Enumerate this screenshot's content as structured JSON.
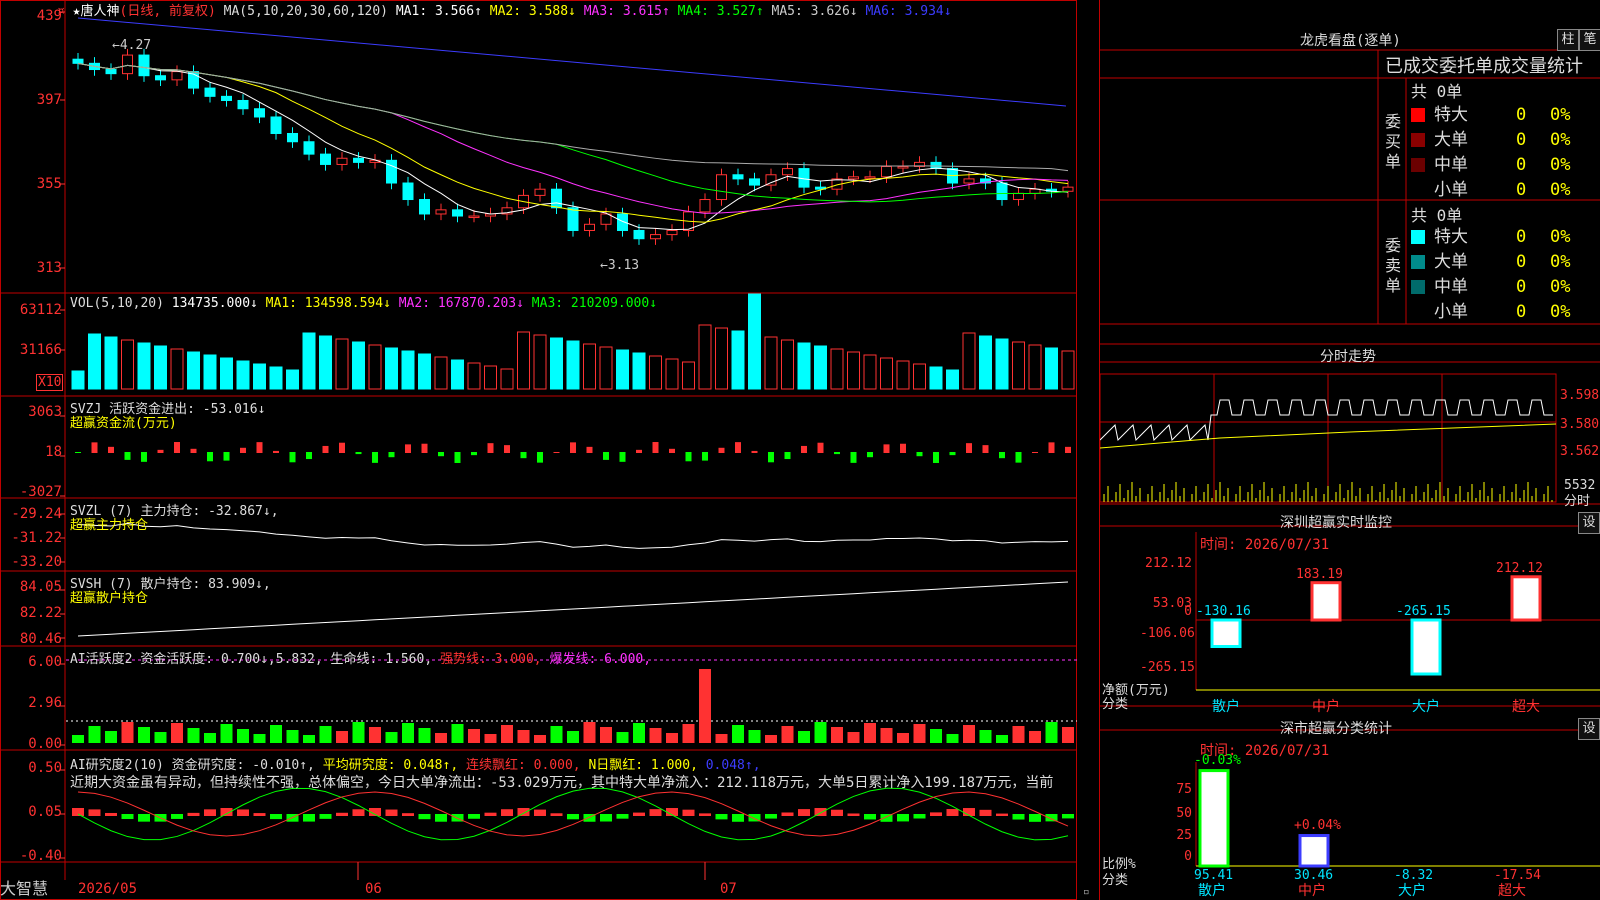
{
  "main": {
    "title_star": "★",
    "stock_name": "唐人神",
    "period": "(日线, 前复权)",
    "ma_label": "MA(5,10,20,30,60,120)",
    "ma1": "MA1: 3.566↑",
    "ma2": "MA2: 3.588↓",
    "ma3": "MA3: 3.615↑",
    "ma4": "MA4: 3.527↑",
    "ma5": "MA5: 3.626↓",
    "ma6": "MA6: 3.934↓",
    "y_ticks": [
      "439",
      "397",
      "355",
      "313"
    ],
    "high_label": "←4.27",
    "low_label": "←3.13",
    "corner_icon": "¤"
  },
  "vol": {
    "label": "VOL(5,10,20)",
    "v": "134735.000↓",
    "ma1": "MA1: 134598.594↓",
    "ma2": "MA2: 167870.203↓",
    "ma3": "MA3: 210209.000↓",
    "y_ticks": [
      "63112",
      "31166"
    ],
    "unit": "X10"
  },
  "svzj": {
    "label": "SVZJ  活跃资金进出: -53.016↓",
    "sub": "超赢资金流(万元)",
    "y_ticks": [
      "3063",
      "18",
      "-3027"
    ]
  },
  "svzl": {
    "label": "SVZL (7) 主力持仓: -32.867↓,",
    "sub": "超赢主力持仓",
    "y_ticks": [
      "-29.24",
      "-31.22",
      "-33.20"
    ]
  },
  "svsh": {
    "label": "SVSH (7) 散户持仓: 83.909↓,",
    "sub": "超赢散户持仓",
    "y_ticks": [
      "84.05",
      "82.22",
      "80.46"
    ]
  },
  "ai1": {
    "label": "AI活跃度2 资金活跃度: 0.700↓,5.832,",
    "life": "生命线: 1.560,",
    "strong": "强势线: 3.000,",
    "burst": "爆发线: 6.000,",
    "y_ticks": [
      "6.00",
      "2.96",
      "0.00"
    ]
  },
  "ai2": {
    "label": "AI研究度2(10) 资金研究度: -0.010↑,",
    "avg": "平均研究度: 0.048↑,",
    "cont": "连续飘红: 0.000,",
    "n": "N日飘红: 1.000,",
    "last": "0.048↑,",
    "comment": "近期大资金虽有异动，但持续性不强，总体偏空，今日大单净流出：-53.029万元，其中特大单净流入：212.118万元，大单5日累计净入199.187万元，当前",
    "y_ticks": [
      "0.50",
      "0.05",
      "-0.40"
    ]
  },
  "xaxis": {
    "brand": "大智慧",
    "labels": [
      "2026/05",
      "06",
      "07"
    ]
  },
  "right": {
    "lhb_title": "龙虎看盘(逐单)",
    "btn_zhu": "柱",
    "btn_bi": "笔",
    "stat_title": "已成交委托单成交量统计",
    "buy_side": "委买单",
    "sell_side": "委卖单",
    "buy_total": "共 0单",
    "sell_total": "共 0单",
    "rows": [
      {
        "name": "特大",
        "n": "0",
        "p": "0%"
      },
      {
        "name": "大单",
        "n": "0",
        "p": "0%"
      },
      {
        "name": "中单",
        "n": "0",
        "p": "0%"
      },
      {
        "name": "小单",
        "n": "0",
        "p": "0%"
      }
    ],
    "buy_colors": [
      "#ff0000",
      "#8b0000",
      "#6b0000",
      "#000000"
    ],
    "sell_colors": [
      "#00ffff",
      "#008b8b",
      "#006b6b",
      "#000000"
    ],
    "fs_title": "分时走势",
    "fs_ticks": [
      "3.598",
      "3.580",
      "3.562"
    ],
    "fs_vol": "5532",
    "fs_vol_unit": "分时",
    "mon_title": "深圳超赢实时监控",
    "mon_btn": "设",
    "mon_time": "时间: 2026/07/31",
    "mon_ticks": [
      "212.12",
      "53.03",
      "0",
      "-106.06",
      "-265.15"
    ],
    "mon_unit1": "净额(万元)",
    "mon_unit2": "分类",
    "mon_bars": [
      {
        "cat": "散户",
        "val": "-130.16"
      },
      {
        "cat": "中户",
        "val": "183.19"
      },
      {
        "cat": "大户",
        "val": "-265.15"
      },
      {
        "cat": "超大",
        "val": "212.12"
      }
    ],
    "cls_title": "深市超赢分类统计",
    "cls_btn": "设",
    "cls_time": "时间: 2026/07/31",
    "cls_ticks": [
      "75",
      "50",
      "25",
      "0"
    ],
    "cls_unit1": "比例%",
    "cls_unit2": "分类",
    "cls_bars": [
      {
        "cat": "散户",
        "top": "-0.03%",
        "val": "95.41"
      },
      {
        "cat": "中户",
        "top": "+0.04%",
        "val": "30.46"
      },
      {
        "cat": "大户",
        "top": "",
        "val": "-8.32"
      },
      {
        "cat": "超大",
        "top": "",
        "val": "-17.54"
      }
    ]
  },
  "colors": {
    "up": "#ff3232",
    "down": "#00ffff",
    "grid": "#c00000"
  }
}
